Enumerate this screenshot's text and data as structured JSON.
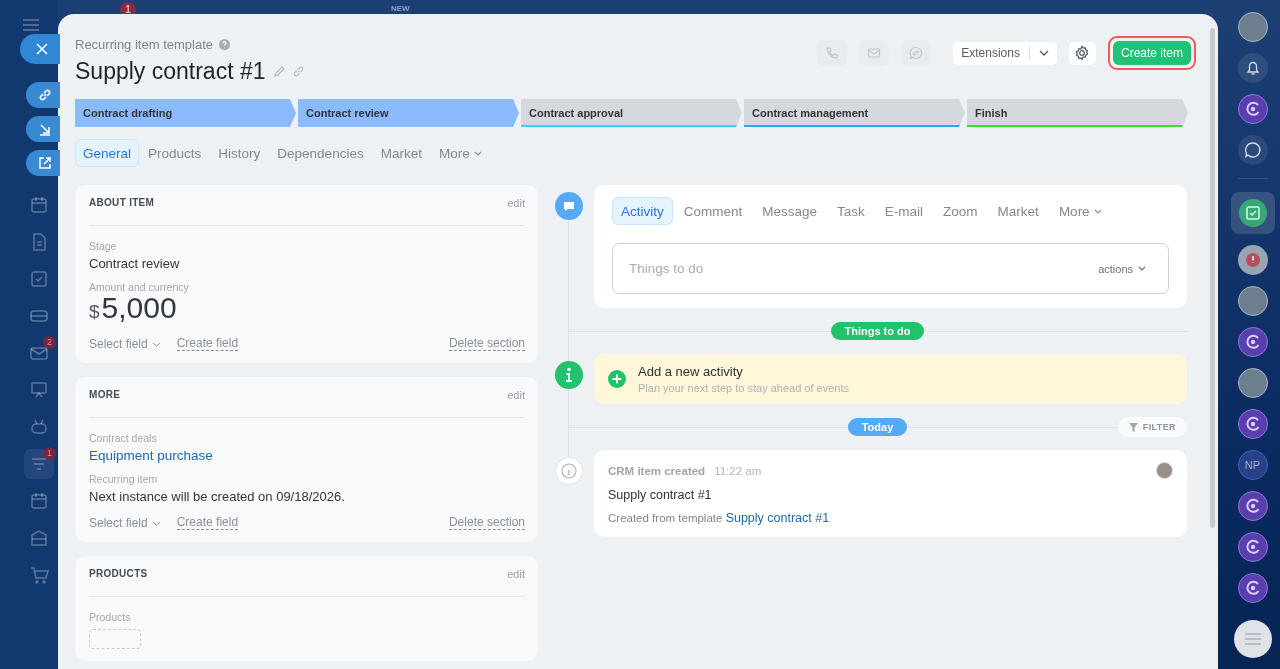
{
  "topbar": {
    "badge": "1",
    "new_label": "NEW"
  },
  "left_nav": [
    {
      "kind": "calendar",
      "selected": false
    },
    {
      "kind": "document",
      "selected": false
    },
    {
      "kind": "task",
      "selected": false
    },
    {
      "kind": "card",
      "selected": false
    },
    {
      "kind": "mail",
      "badge": "2",
      "selected": false
    },
    {
      "kind": "board",
      "selected": false
    },
    {
      "kind": "robot",
      "selected": false
    },
    {
      "kind": "filter",
      "badge": "1",
      "selected": true
    },
    {
      "kind": "calendar",
      "selected": false
    },
    {
      "kind": "storage",
      "selected": false
    },
    {
      "kind": "cart",
      "selected": false
    }
  ],
  "header": {
    "subtitle": "Recurring item template",
    "title": "Supply contract #1"
  },
  "toolbar": {
    "icons": [
      {
        "kind": "phone",
        "disabled": true
      },
      {
        "kind": "mail",
        "disabled": true
      },
      {
        "kind": "chat",
        "disabled": true
      }
    ],
    "extensions": "Extensions",
    "create_button": {
      "label": "Create item",
      "highlighted": true
    }
  },
  "stages": [
    {
      "label": "Contract drafting",
      "done": true,
      "color": "#8bbbff"
    },
    {
      "label": "Contract review",
      "done": true,
      "color": "#8bbbff"
    },
    {
      "label": "Contract approval",
      "done": false,
      "color": "#2fd9f6"
    },
    {
      "label": "Contract management",
      "done": false,
      "color": "#1eaef0"
    },
    {
      "label": "Finish",
      "done": false,
      "color": "#2fe620"
    }
  ],
  "tabs": [
    {
      "label": "General",
      "selected": true
    },
    {
      "label": "Products",
      "selected": false
    },
    {
      "label": "History",
      "selected": false
    },
    {
      "label": "Dependencies",
      "selected": false
    },
    {
      "label": "Market",
      "selected": false
    },
    {
      "label": "More",
      "selected": false,
      "dropdown": true
    }
  ],
  "sections": [
    {
      "title": "ABOUT ITEM",
      "edit": "edit",
      "fields": [
        {
          "kind": "text",
          "label": "Stage",
          "value": "Contract review"
        },
        {
          "kind": "money",
          "label": "Amount and currency",
          "currency": "$",
          "value": "5,000"
        }
      ],
      "footer": {
        "select": "Select field",
        "create": "Create field",
        "delete": "Delete section"
      }
    },
    {
      "title": "MORE",
      "edit": "edit",
      "fields": [
        {
          "kind": "link",
          "label": "Contract deals",
          "value": "Equipment purchase"
        },
        {
          "kind": "text",
          "label": "Recurring item",
          "value": "Next instance will be created on 09/18/2026."
        }
      ],
      "footer": {
        "select": "Select field",
        "create": "Create field",
        "delete": "Delete section"
      }
    },
    {
      "title": "PRODUCTS",
      "edit": "edit",
      "fields": [
        {
          "kind": "products",
          "label": "Products"
        }
      ]
    }
  ],
  "timeline": {
    "tabs": [
      {
        "label": "Activity",
        "selected": true
      },
      {
        "label": "Comment",
        "selected": false
      },
      {
        "label": "Message",
        "selected": false
      },
      {
        "label": "Task",
        "selected": false
      },
      {
        "label": "E-mail",
        "selected": false
      },
      {
        "label": "Zoom",
        "selected": false
      },
      {
        "label": "Market",
        "selected": false
      },
      {
        "label": "More",
        "selected": false,
        "dropdown": true
      }
    ],
    "input_placeholder": "Things to do",
    "actions": "actions",
    "todo_pill": "Things to do",
    "new_activity": {
      "title": "Add a new activity",
      "subtitle": "Plan your next step to stay ahead of events"
    },
    "today_pill": "Today",
    "filter": "FILTER",
    "entry": {
      "title": "CRM item created",
      "time": "11:22 am",
      "body": "Supply contract #1",
      "note": "Created from template",
      "link": "Supply contract #1"
    }
  },
  "right_nav": [
    {
      "kind": "avatar"
    },
    {
      "kind": "bell"
    },
    {
      "kind": "copilot"
    },
    {
      "kind": "chat"
    },
    {
      "kind": "divider"
    },
    {
      "kind": "task",
      "selected": true
    },
    {
      "kind": "alert"
    },
    {
      "kind": "avatar"
    },
    {
      "kind": "copilot"
    },
    {
      "kind": "avatar"
    },
    {
      "kind": "copilot"
    },
    {
      "kind": "initials",
      "text": "NP"
    },
    {
      "kind": "copilot"
    },
    {
      "kind": "copilot"
    },
    {
      "kind": "copilot"
    }
  ]
}
